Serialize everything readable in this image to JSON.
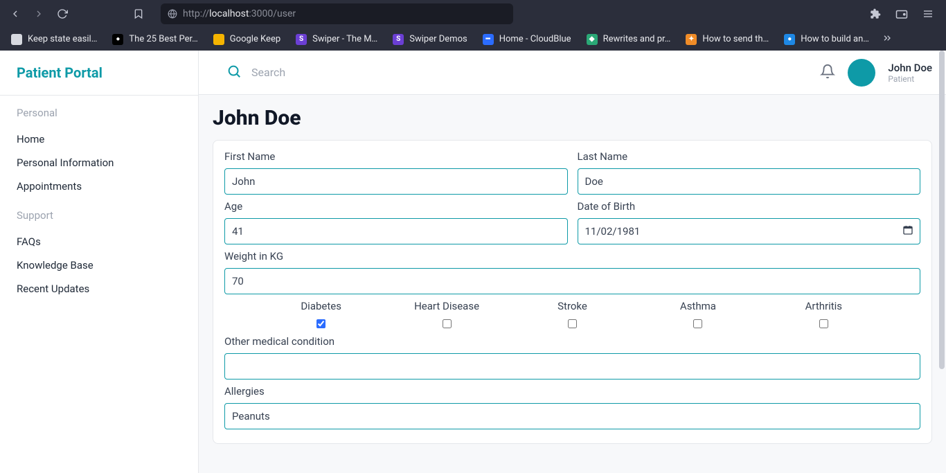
{
  "browser": {
    "url_prefix": "http://",
    "url_host": "localhost",
    "url_port_path": ":3000/user",
    "bookmarks": [
      {
        "label": "Keep state easil…",
        "bg": "#d7d9e0",
        "glyph": ""
      },
      {
        "label": "The 25 Best Per…",
        "bg": "#000000",
        "glyph": "●"
      },
      {
        "label": "Google Keep",
        "bg": "#f5b400",
        "glyph": ""
      },
      {
        "label": "Swiper - The M…",
        "bg": "#6b3fd4",
        "glyph": "S"
      },
      {
        "label": "Swiper Demos",
        "bg": "#6b3fd4",
        "glyph": "S"
      },
      {
        "label": "Home - CloudBlue",
        "bg": "#2b6cff",
        "glyph": "━"
      },
      {
        "label": "Rewrites and pr…",
        "bg": "#2aa876",
        "glyph": "◆"
      },
      {
        "label": "How to send th…",
        "bg": "#f08c28",
        "glyph": "✦"
      },
      {
        "label": "How to build an…",
        "bg": "#1e88e5",
        "glyph": "●"
      }
    ]
  },
  "app": {
    "brand": "Patient Portal",
    "sidebar": {
      "personal_label": "Personal",
      "support_label": "Support",
      "personal_items": [
        "Home",
        "Personal Information",
        "Appointments"
      ],
      "support_items": [
        "FAQs",
        "Knowledge Base",
        "Recent Updates"
      ]
    },
    "topbar": {
      "search_placeholder": "Search",
      "user_name": "John Doe",
      "user_role": "Patient"
    },
    "page": {
      "title": "John Doe",
      "labels": {
        "first_name": "First Name",
        "last_name": "Last Name",
        "age": "Age",
        "dob": "Date of Birth",
        "weight": "Weight in KG",
        "other": "Other medical condition",
        "allergies": "Allergies"
      },
      "values": {
        "first_name": "John",
        "last_name": "Doe",
        "age": "41",
        "dob": "11/02/1981",
        "weight": "70",
        "other": "",
        "allergies": "Peanuts"
      },
      "conditions": [
        {
          "label": "Diabetes",
          "checked": true
        },
        {
          "label": "Heart Disease",
          "checked": false
        },
        {
          "label": "Stroke",
          "checked": false
        },
        {
          "label": "Asthma",
          "checked": false
        },
        {
          "label": "Arthritis",
          "checked": false
        }
      ]
    }
  }
}
